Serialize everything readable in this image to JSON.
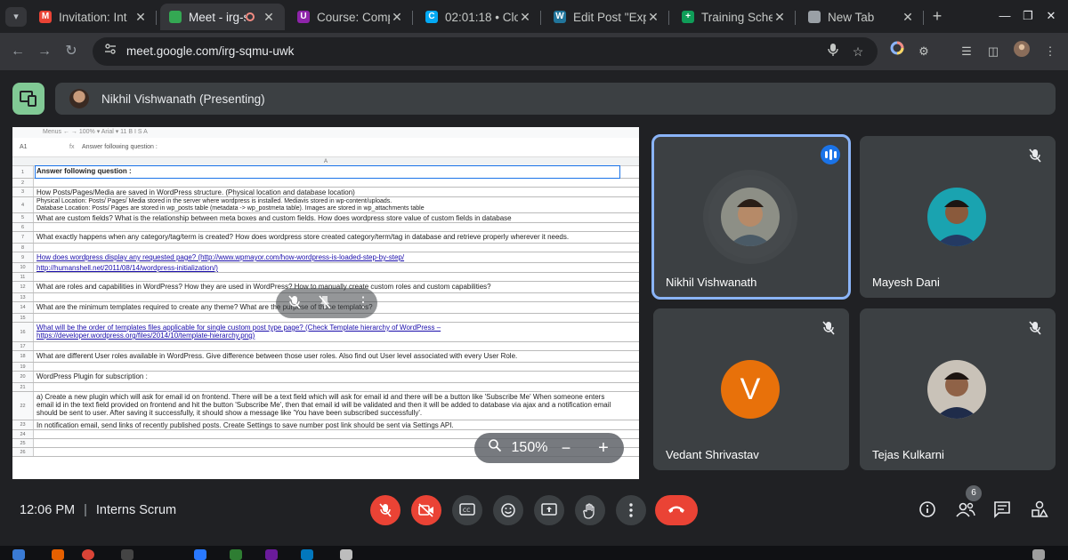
{
  "browser": {
    "tabs": [
      {
        "title": "Invitation: Int",
        "favicon": "gmail-icon",
        "color": "#ea4335",
        "glyph": "M"
      },
      {
        "title": "Meet - irg-s",
        "favicon": "meet-icon",
        "color": "#34a853",
        "glyph": "",
        "active": true
      },
      {
        "title": "Course: Comp",
        "favicon": "course-icon",
        "color": "#8e24aa",
        "glyph": "U"
      },
      {
        "title": "02:01:18 • Clo",
        "favicon": "clockify-icon",
        "color": "#03a9f4",
        "glyph": "C"
      },
      {
        "title": "Edit Post \"Exp",
        "favicon": "wordpress-icon",
        "color": "#21759b",
        "glyph": "W"
      },
      {
        "title": "Training Sche",
        "favicon": "sheets-icon",
        "color": "#0f9d58",
        "glyph": "+"
      },
      {
        "title": "New Tab",
        "favicon": "chrome-icon",
        "color": "#9aa0a6",
        "glyph": ""
      }
    ],
    "url": "meet.google.com/irg-sqmu-uwk"
  },
  "meet": {
    "presenter_label": "Nikhil Vishwanath (Presenting)",
    "time": "12:06 PM",
    "meeting_name": "Interns Scrum",
    "divider": "|",
    "participant_count": "6",
    "zoom_level": "150%",
    "participants": [
      {
        "name": "Nikhil Vishwanath",
        "speaking": true
      },
      {
        "name": "Mayesh Dani",
        "muted": true
      },
      {
        "name": "Vedant Shrivastav",
        "muted": true,
        "initial": "V"
      },
      {
        "name": "Tejas Kulkarni",
        "muted": true
      }
    ],
    "accent_end_call": "#ea4335",
    "accent_active": "#8ab4f8"
  },
  "sheet": {
    "cell_ref": "A1",
    "fx": "fx",
    "formula_text": "Answer following question :",
    "column_label": "A",
    "toolbar_text": "Menus  ←  →  100%  ▾  Arial  ▾  11  B  I  S  A",
    "rows": [
      {
        "n": "1",
        "text": "Answer following question :",
        "style": "bold",
        "h": 14
      },
      {
        "n": "2",
        "text": "",
        "h": 10
      },
      {
        "n": "3",
        "text": "How Posts/Pages/Media are saved in WordPress structure. (Physical location and database location)",
        "h": 11
      },
      {
        "n": "4",
        "text": "Physical Location: Posts/ Pages/ Media stored in the server where wordpress is installed. Mediavis stored in wp-content/uploads.\nDatabase Location: Posts/ Pages are stored in wp_posts  table (metadata -> wp_postmeta table). Images are stored in wp_attachments table",
        "style": "small",
        "h": 18
      },
      {
        "n": "5",
        "text": "What are custom fields? What is the relationship between meta boxes and custom fields. How does wordpress store value of custom fields in database",
        "h": 11
      },
      {
        "n": "6",
        "text": "",
        "h": 10
      },
      {
        "n": "7",
        "text": "What exactly happens when any category/tag/term is created? How does wordpress store created category/term/tag in database and retrieve properly wherever it needs.",
        "h": 13
      },
      {
        "n": "8",
        "text": "",
        "h": 10
      },
      {
        "n": "9",
        "text": "How does wordpress display any requested page? (http://www.wpmayor.com/how-wordpress-is-loaded-step-by-step/",
        "style": "link",
        "h": 12
      },
      {
        "n": "10",
        "text": "http://humanshell.net/2011/08/14/wordpress-initialization/)",
        "style": "link",
        "h": 11
      },
      {
        "n": "11",
        "text": "",
        "h": 10
      },
      {
        "n": "12",
        "text": "What are roles and capabilities in WordPress? How they are used in WordPress? How to manually create custom roles and custom capabilities?",
        "h": 13
      },
      {
        "n": "13",
        "text": "",
        "h": 10
      },
      {
        "n": "14",
        "text": "What are the minimum templates required to create any theme? What are the purpose of those templates?",
        "h": 13
      },
      {
        "n": "15",
        "text": "",
        "h": 10
      },
      {
        "n": "16",
        "text": "What will be the order of templates files applicable for single custom post type page? (Check Template hierarchy of WordPress –\nhttps://developer.wordpress.org/files/2014/10/template-hierarchy.png)",
        "style": "link",
        "h": 22
      },
      {
        "n": "17",
        "text": "",
        "h": 10
      },
      {
        "n": "18",
        "text": "What are different User roles available in WordPress. Give difference between those user roles. Also find out User level associated with every User Role.",
        "h": 13
      },
      {
        "n": "19",
        "text": "",
        "h": 10
      },
      {
        "n": "20",
        "text": "WordPress Plugin for subscription :",
        "h": 13
      },
      {
        "n": "21",
        "text": "",
        "h": 10
      },
      {
        "n": "22",
        "text": "a) Create a new plugin which will ask for email id on frontend. There will be a text field which will ask for email id and there will be a button like 'Subscribe Me' When someone enters email id in the text field provided on frontend and hit the button 'Subscribe Me', then that email id will be validated and then it will be added to database via ajax and a notification email should be sent to user. After saving it successfully, it should show a message like 'You have been subscribed successfully'.",
        "h": 32
      },
      {
        "n": "23",
        "text": "In notification email, send links of recently published posts. Create Settings to save number post link should be sent via Settings API.",
        "h": 11
      },
      {
        "n": "24",
        "text": "",
        "h": 10
      },
      {
        "n": "25",
        "text": "",
        "h": 10
      },
      {
        "n": "26",
        "text": "",
        "h": 10
      }
    ]
  }
}
